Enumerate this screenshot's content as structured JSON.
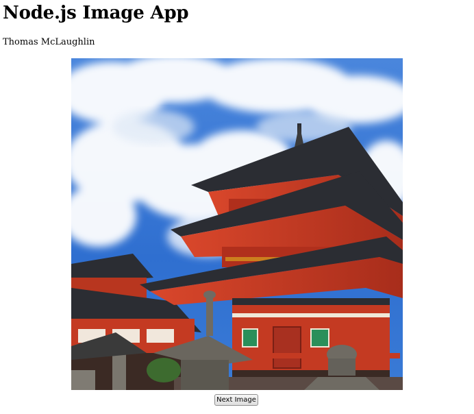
{
  "page": {
    "title": "Node.js Image App",
    "author": "Thomas McLaughlin"
  },
  "image": {
    "subject": "pagoda-photo",
    "colors": {
      "sky": "#2f6fd0",
      "cloud": "#ffffff",
      "pagoda_red": "#c83a22",
      "roof_dark": "#2b2d33",
      "stone": "#6f6b63",
      "window_green": "#2a8f5a"
    }
  },
  "controls": {
    "next_label": "Next Image"
  }
}
